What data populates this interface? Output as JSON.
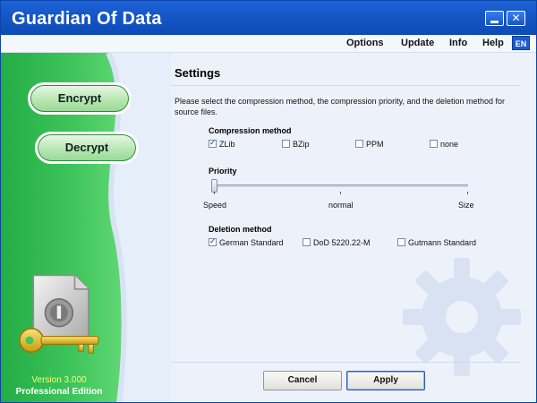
{
  "window": {
    "title": "Guardian Of Data",
    "minimize_icon": "minimize-icon",
    "close_icon": "close-icon",
    "close_glyph": "✕"
  },
  "menu": {
    "items": [
      "Options",
      "Update",
      "Info",
      "Help"
    ],
    "language": "EN"
  },
  "sidebar": {
    "encrypt_label": "Encrypt",
    "decrypt_label": "Decrypt",
    "illustration_icon": "locked-document-with-key-icon",
    "version": "Version 3.000",
    "edition": "Professional Edition"
  },
  "settings": {
    "title": "Settings",
    "description": "Please select the compression method, the compression priority, and the deletion method for source files.",
    "compression": {
      "label": "Compression method",
      "options": [
        {
          "label": "ZLib",
          "checked": true
        },
        {
          "label": "BZip",
          "checked": false
        },
        {
          "label": "PPM",
          "checked": false
        },
        {
          "label": "none",
          "checked": false
        }
      ]
    },
    "priority": {
      "label": "Priority",
      "tick_labels": [
        "Speed",
        "normal",
        "Size"
      ],
      "value": 0
    },
    "deletion": {
      "label": "Deletion method",
      "options": [
        {
          "label": "German Standard",
          "checked": true
        },
        {
          "label": "DoD 5220.22-M",
          "checked": false
        },
        {
          "label": "Gutmann Standard",
          "checked": false
        }
      ]
    }
  },
  "buttons": {
    "cancel": "Cancel",
    "apply": "Apply"
  },
  "colors": {
    "title_bar": "#1657c8",
    "sidebar_green": "#44c85f",
    "accent_blue": "#1a5ccc"
  }
}
